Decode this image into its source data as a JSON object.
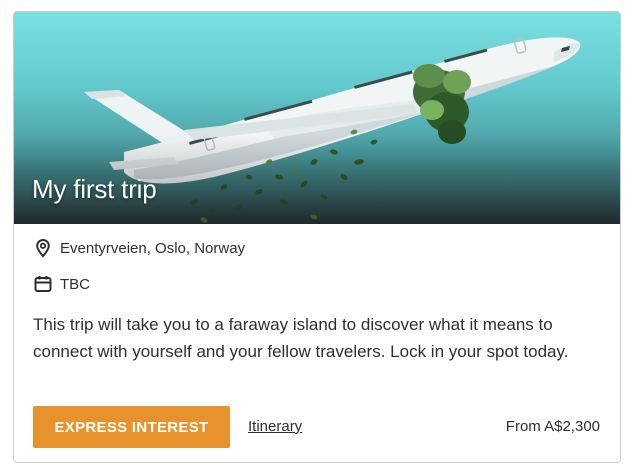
{
  "card": {
    "title": "My first trip",
    "location": "Eventyrveien, Oslo, Norway",
    "date": "TBC",
    "description": "This trip will take you to a faraway island to discover what it means to connect with yourself and your fellow travelers. Lock in your spot today.",
    "primary_button": "EXPRESS INTEREST",
    "secondary_link": "Itinerary",
    "price": "From A$2,300"
  },
  "icons": {
    "location": "location-pin-icon",
    "date": "calendar-icon"
  },
  "colors": {
    "accent": "#e8922d",
    "text": "#2b2f33",
    "sky_top": "#7be0e4",
    "border": "#c9cdd2"
  }
}
